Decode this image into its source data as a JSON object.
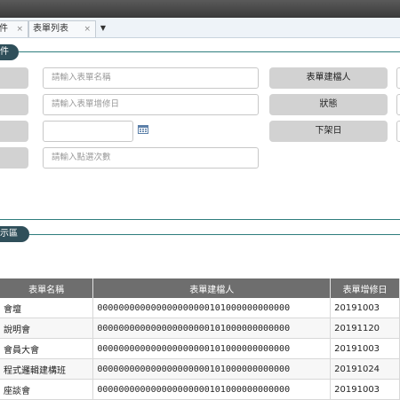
{
  "tabs": [
    {
      "label": "件",
      "close": "×"
    },
    {
      "label": "表單列表",
      "close": "×"
    }
  ],
  "tab_menu_icon": "caret-down-icon",
  "query_section": {
    "title": "件"
  },
  "form": {
    "left_placeholders": [
      "請輸入表單名稱",
      "請輸入表單增修日",
      "",
      "請輸入點選次數"
    ],
    "right_labels": [
      "表單建檔人",
      "狀態",
      "下架日"
    ],
    "calendar_icon": "calendar-icon"
  },
  "display_section": {
    "title": "示區"
  },
  "table": {
    "headers": [
      "表單名稱",
      "表單建檔人",
      "表單增修日"
    ],
    "rows": [
      {
        "name": "會壇",
        "creator": "000000000000000000000101000000000000",
        "date": "20191003"
      },
      {
        "name": "說明會",
        "creator": "000000000000000000000101000000000000",
        "date": "20191120"
      },
      {
        "name": "會員大會",
        "creator": "000000000000000000000101000000000000",
        "date": "20191003"
      },
      {
        "name": "程式邏輯建構班",
        "creator": "000000000000000000000101000000000000",
        "date": "20191024"
      },
      {
        "name": "座談會",
        "creator": "000000000000000000000101000000000000",
        "date": "20191003"
      }
    ]
  }
}
